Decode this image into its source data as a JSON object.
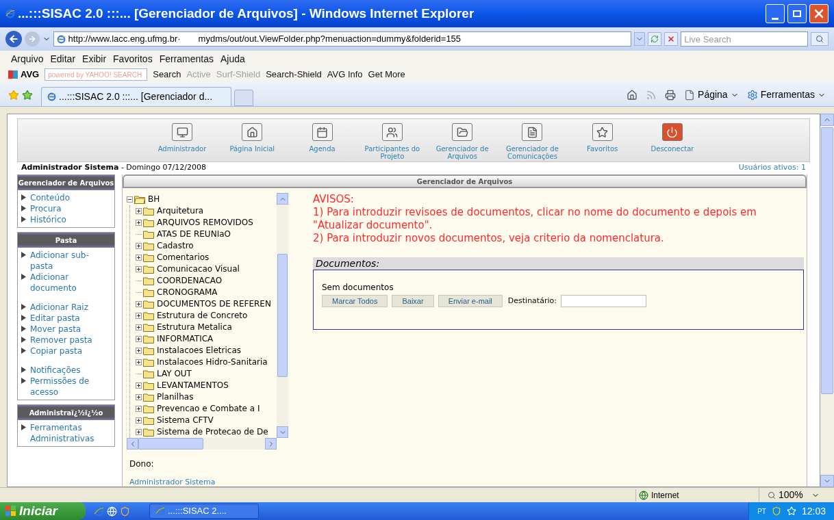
{
  "window": {
    "title": "...:::SISAC 2.0 :::... [Gerenciador de Arquivos] - Windows Internet Explorer"
  },
  "address_bar": {
    "url_start": "http://www.lacc.eng.ufmg.br·",
    "url_end": "mydms/out/out.ViewFolder.php?menuaction=dummy&folderid=155",
    "search_placeholder": "Live Search"
  },
  "menu": [
    "Arquivo",
    "Editar",
    "Exibir",
    "Favoritos",
    "Ferramentas",
    "Ajuda"
  ],
  "avg_toolbar": {
    "brand": "AVG",
    "search_placeholder": "powered by YAHOO! SEARCH",
    "items": [
      {
        "label": "Search",
        "disabled": false
      },
      {
        "label": "Active",
        "disabled": true
      },
      {
        "label": "Surf-Shield",
        "disabled": true
      },
      {
        "label": "Search-Shield",
        "disabled": false
      },
      {
        "label": "AVG Info",
        "disabled": false
      },
      {
        "label": "Get More",
        "disabled": false
      }
    ]
  },
  "tabs": [
    {
      "label": "...:::SISAC 2.0 :::... [Gerenciador d...",
      "selected": true
    }
  ],
  "command_bar": [
    "Página",
    "Ferramentas"
  ],
  "nav": [
    {
      "label": "Administrador"
    },
    {
      "label": "Página Inicial"
    },
    {
      "label": "Agenda"
    },
    {
      "label": "Participantes do Projeto"
    },
    {
      "label": "Gerenciador de Arquivos"
    },
    {
      "label": "Gerenciador de Comunicações"
    },
    {
      "label": "Favoritos"
    },
    {
      "label": "Desconectar"
    }
  ],
  "user_line": {
    "name": "Administrador Sistema",
    "date": "- Domingo 07/12/2008",
    "active_users": "Usuários ativos: 1"
  },
  "sidebar": [
    {
      "title": "Gerenciador de Arquivos",
      "groups": [
        [
          "Conteúdo",
          "Procura",
          "Histórico"
        ]
      ]
    },
    {
      "title": "Pasta",
      "groups": [
        [
          "Adicionar sub-pasta",
          "Adicionar documento"
        ],
        [
          "Adicionar Raiz",
          "Editar pasta",
          "Mover pasta",
          "Remover pasta",
          "Copiar pasta"
        ],
        [
          "Notificações",
          "Permissões de acesso"
        ]
      ]
    },
    {
      "title": "Administraï¿½ï¿½o",
      "groups": [
        [
          "Ferramentas Administrativas"
        ]
      ]
    }
  ],
  "panel_title": "Gerenciador de Arquivos",
  "tree": {
    "label": "BH",
    "expanded": true,
    "children": [
      {
        "label": "Arquitetura",
        "expandable": true
      },
      {
        "label": "ARQUIVOS REMOVIDOS",
        "expandable": true
      },
      {
        "label": "ATAS DE REUNIaO",
        "expandable": false
      },
      {
        "label": "Cadastro",
        "expandable": true
      },
      {
        "label": "Comentarios",
        "expandable": true
      },
      {
        "label": "Comunicacao Visual",
        "expandable": true
      },
      {
        "label": "COORDENACAO",
        "expandable": false
      },
      {
        "label": "CRONOGRAMA",
        "expandable": false
      },
      {
        "label": "DOCUMENTOS DE REFEREN",
        "expandable": true
      },
      {
        "label": "Estrutura de Concreto",
        "expandable": true
      },
      {
        "label": "Estrutura Metalica",
        "expandable": true
      },
      {
        "label": "INFORMATICA",
        "expandable": true
      },
      {
        "label": "Instalacoes Eletricas",
        "expandable": true
      },
      {
        "label": "Instalacoes Hidro-Sanitaria",
        "expandable": true
      },
      {
        "label": "LAY OUT",
        "expandable": false
      },
      {
        "label": "LEVANTAMENTOS",
        "expandable": true
      },
      {
        "label": "Planilhas",
        "expandable": true
      },
      {
        "label": "Prevencao e Combate a I",
        "expandable": true
      },
      {
        "label": "Sistema CFTV",
        "expandable": true
      },
      {
        "label": "Sistema de Protecao de De",
        "expandable": true
      }
    ]
  },
  "owner": {
    "label": "Dono:",
    "name": "Administrador Sistema"
  },
  "notices": {
    "title": "AVISOS:",
    "lines": [
      "1) Para introduzir revisoes de documentos, clicar no nome do documento e depois em \"Atualizar documento\".",
      "2) Para introduzir novos documentos, veja criterio da nomenclatura."
    ]
  },
  "documents": {
    "title": "Documentos:",
    "empty_text": "Sem documentos",
    "buttons": [
      "Marcar Todos",
      "Baixar",
      "Enviar e-mail"
    ],
    "recipient_label": "Destinatário:"
  },
  "status_bar": {
    "zone": "Internet",
    "zoom": "100%"
  },
  "taskbar": {
    "start": "Iniciar",
    "window": "...:::SISAC 2....",
    "language": "PT",
    "clock": "12:03"
  }
}
